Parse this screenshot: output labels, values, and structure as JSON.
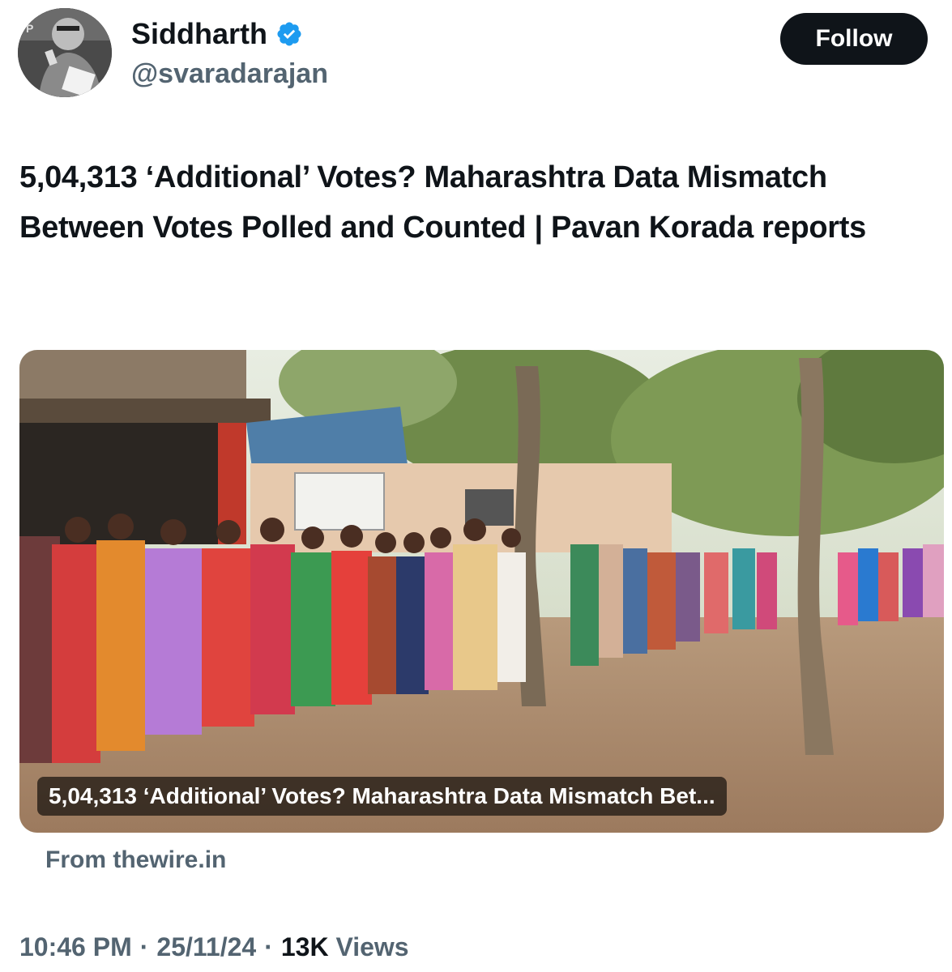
{
  "author": {
    "display_name": "Siddharth",
    "handle": "@svaradarajan",
    "verified_icon": "verified-badge-icon",
    "avatar_badge_text": "Free The Press"
  },
  "follow_button": {
    "label": "Follow"
  },
  "tweet": {
    "text": "5,04,313 ‘Additional’ Votes? Maharashtra Data Mismatch Between Votes Polled and Counted | Pavan Korada reports"
  },
  "link_card": {
    "caption": "5,04,313 ‘Additional’ Votes? Maharashtra Data Mismatch Bet...",
    "source": "From thewire.in"
  },
  "meta": {
    "time": "10:46 PM",
    "separator": "·",
    "date": "25/11/24",
    "views_count": "13K",
    "views_label": "Views"
  },
  "colors": {
    "text_primary": "#0f1419",
    "text_secondary": "#536471",
    "verified_blue": "#1d9bf0",
    "follow_bg": "#0f1419"
  }
}
